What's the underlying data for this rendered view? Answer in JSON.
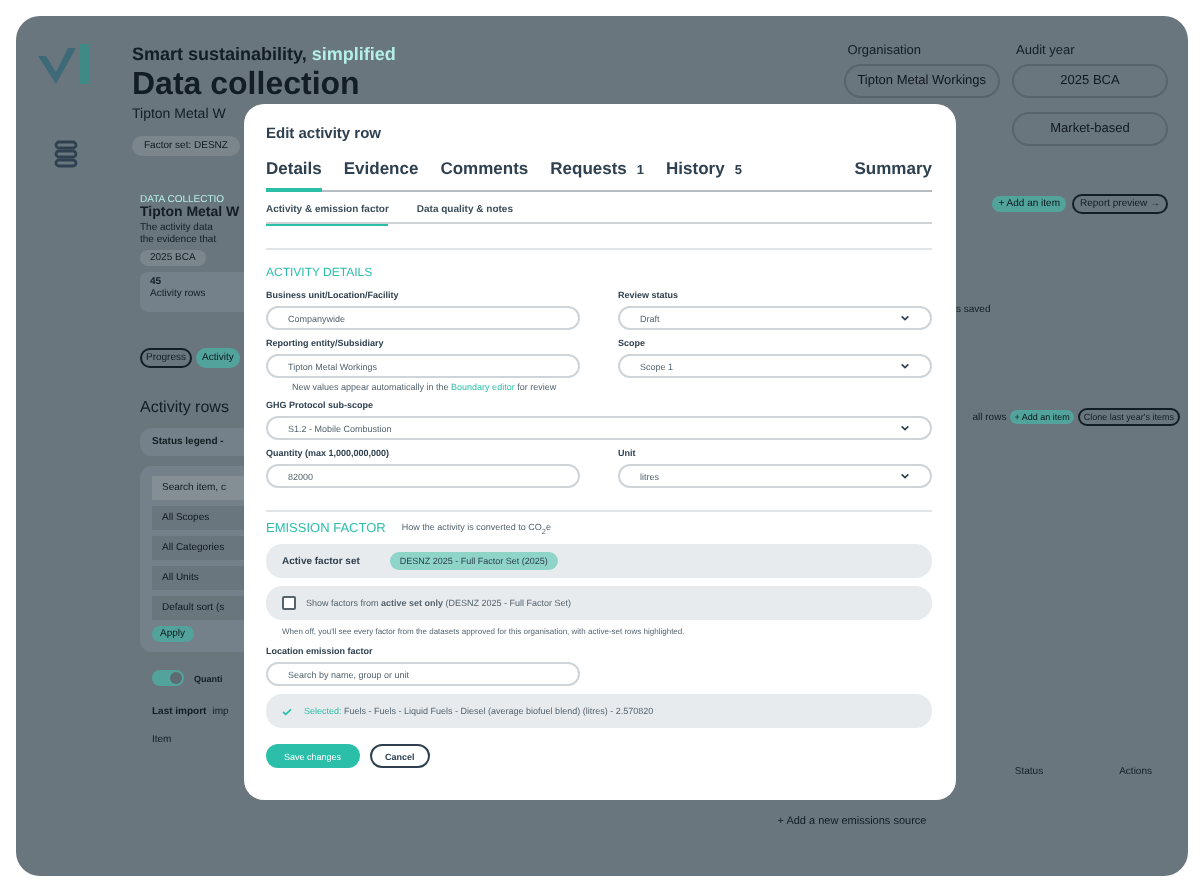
{
  "header": {
    "tagline": "Smart sustainability,",
    "tagline_accent": "simplified",
    "title": "Data collection",
    "subtitle": "Tipton Metal W",
    "factor_chip": "Factor set: DESNZ"
  },
  "org": {
    "label": "Organisation",
    "value": "Tipton Metal Workings"
  },
  "audit": {
    "label": "Audit year",
    "value": "2025 BCA"
  },
  "basis": "Market-based",
  "background": {
    "section_label": "DATA COLLECTIO",
    "section_title": "Tipton Metal W",
    "description": [
      "The activity data",
      "the evidence that"
    ],
    "year_chip": "2025 BCA",
    "stat_value": "45",
    "stat_label": "Activity rows",
    "saved_note": "s saved",
    "top_actions": [
      "+ Add an item",
      "Report preview →"
    ],
    "view_pills": [
      {
        "label": "Progress",
        "selected": false
      },
      {
        "label": "Activity",
        "selected": true
      }
    ],
    "row_actions": {
      "note": "all rows",
      "buttons": [
        "+ Add an item",
        "Clone last year's items"
      ]
    },
    "rows_title": "Activity rows",
    "legend": "Status legend -",
    "filters": [
      {
        "label": "Search item, c",
        "kind": "search"
      },
      {
        "label": "All Scopes",
        "kind": "select"
      },
      {
        "label": "All Categories",
        "kind": "select"
      },
      {
        "label": "All Units",
        "kind": "select"
      },
      {
        "label": "Default sort (s",
        "kind": "select"
      }
    ],
    "apply": "Apply",
    "toggle": {
      "label": "Quanti",
      "on": true
    },
    "last_import": {
      "label": "Last import",
      "value": "imp"
    },
    "columns": [
      "Item",
      "Status",
      "Actions"
    ],
    "add_source": "+ Add a new emissions source"
  },
  "modal": {
    "title": "Edit activity row",
    "tabs": [
      {
        "label": "Details",
        "selected": true
      },
      {
        "label": "Evidence",
        "selected": false
      },
      {
        "label": "Comments",
        "selected": false
      },
      {
        "label": "Requests",
        "count": "1",
        "selected": false
      },
      {
        "label": "History",
        "count": "5",
        "selected": false
      }
    ],
    "summary_tab": "Summary",
    "subtabs": [
      {
        "label": "Activity & emission factor",
        "selected": true
      },
      {
        "label": "Data quality & notes",
        "selected": false
      }
    ],
    "activity_heading": "ACTIVITY DETAILS",
    "business_unit": {
      "label": "Business unit/Location/Facility",
      "value": "Companywide"
    },
    "review_status": {
      "label": "Review status",
      "value": "Draft"
    },
    "entity": {
      "label": "Reporting entity/Subsidiary",
      "value": "Tipton Metal Workings"
    },
    "scope": {
      "label": "Scope",
      "value": "Scope 1"
    },
    "entity_note": {
      "before": "New values appear automatically in the",
      "link": "Boundary editor",
      "after": "for review"
    },
    "subscope": {
      "label": "GHG Protocol sub-scope",
      "value": "S1.2 - Mobile Combustion"
    },
    "quantity": {
      "label": "Quantity (max 1,000,000,000)",
      "value": "82000"
    },
    "unit": {
      "label": "Unit",
      "value": "litres"
    },
    "ef_heading": "EMISSION FACTOR",
    "ef_hint": "How the activity is converted to CO$_{2}$e",
    "active_set": {
      "label": "Active factor set",
      "badge": "DESNZ 2025 - Full Factor Set (2025)"
    },
    "active_only": {
      "text": "Show factors from **active set only** (DESNZ 2025 - Full Factor Set)",
      "checked": false
    },
    "active_note": "When off, you'll see every factor from the datasets approved for this organisation, with active-set rows highlighted.",
    "location": {
      "label": "Location emission factor",
      "placeholder": "Search by name, group or unit"
    },
    "selected": {
      "prefix": "Selected:",
      "value": "Fuels - Fuels - Liquid Fuels - Diesel (average biofuel blend) (litres) - 2.570820"
    },
    "buttons": [
      {
        "label": "Save changes",
        "kind": "primary"
      },
      {
        "label": "Cancel",
        "kind": "secondary"
      }
    ]
  }
}
